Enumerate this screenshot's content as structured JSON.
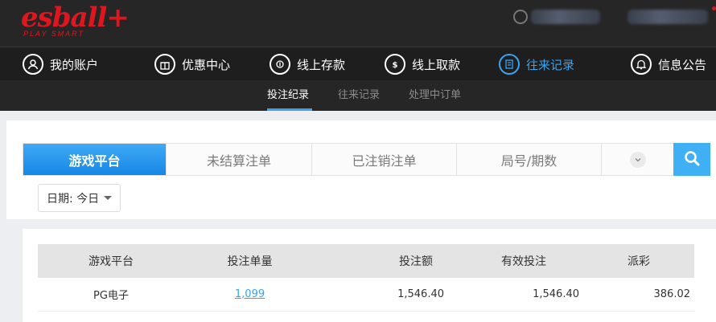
{
  "header": {
    "logo_text": "esball+",
    "logo_sub": "PLAY SMART"
  },
  "nav": [
    {
      "label": "我的账户",
      "icon": "user-icon"
    },
    {
      "label": "优惠中心",
      "icon": "gift-icon"
    },
    {
      "label": "线上存款",
      "icon": "deposit-icon"
    },
    {
      "label": "线上取款",
      "icon": "withdraw-icon"
    },
    {
      "label": "往来记录",
      "icon": "records-icon",
      "active": true
    },
    {
      "label": "信息公告",
      "icon": "bell-icon"
    }
  ],
  "subnav": [
    {
      "label": "投注纪录",
      "active": true
    },
    {
      "label": "往来记录"
    },
    {
      "label": "处理中订单"
    }
  ],
  "filter": {
    "tabs": [
      "游戏平台",
      "未结算注单",
      "已注销注单",
      "局号/期数"
    ],
    "date_label": "日期: 今日"
  },
  "table": {
    "headers": [
      "游戏平台",
      "投注单量",
      "投注额",
      "有效投注",
      "派彩"
    ],
    "rows": [
      {
        "platform": "PG电子",
        "bet_count": "1,099",
        "bet_amount": "1,546.40",
        "valid_bet": "1,546.40",
        "payout": "386.02"
      }
    ]
  },
  "colors": {
    "accent": "#3aa3f0",
    "brand": "#e0161f",
    "header_bg": "#262626"
  }
}
